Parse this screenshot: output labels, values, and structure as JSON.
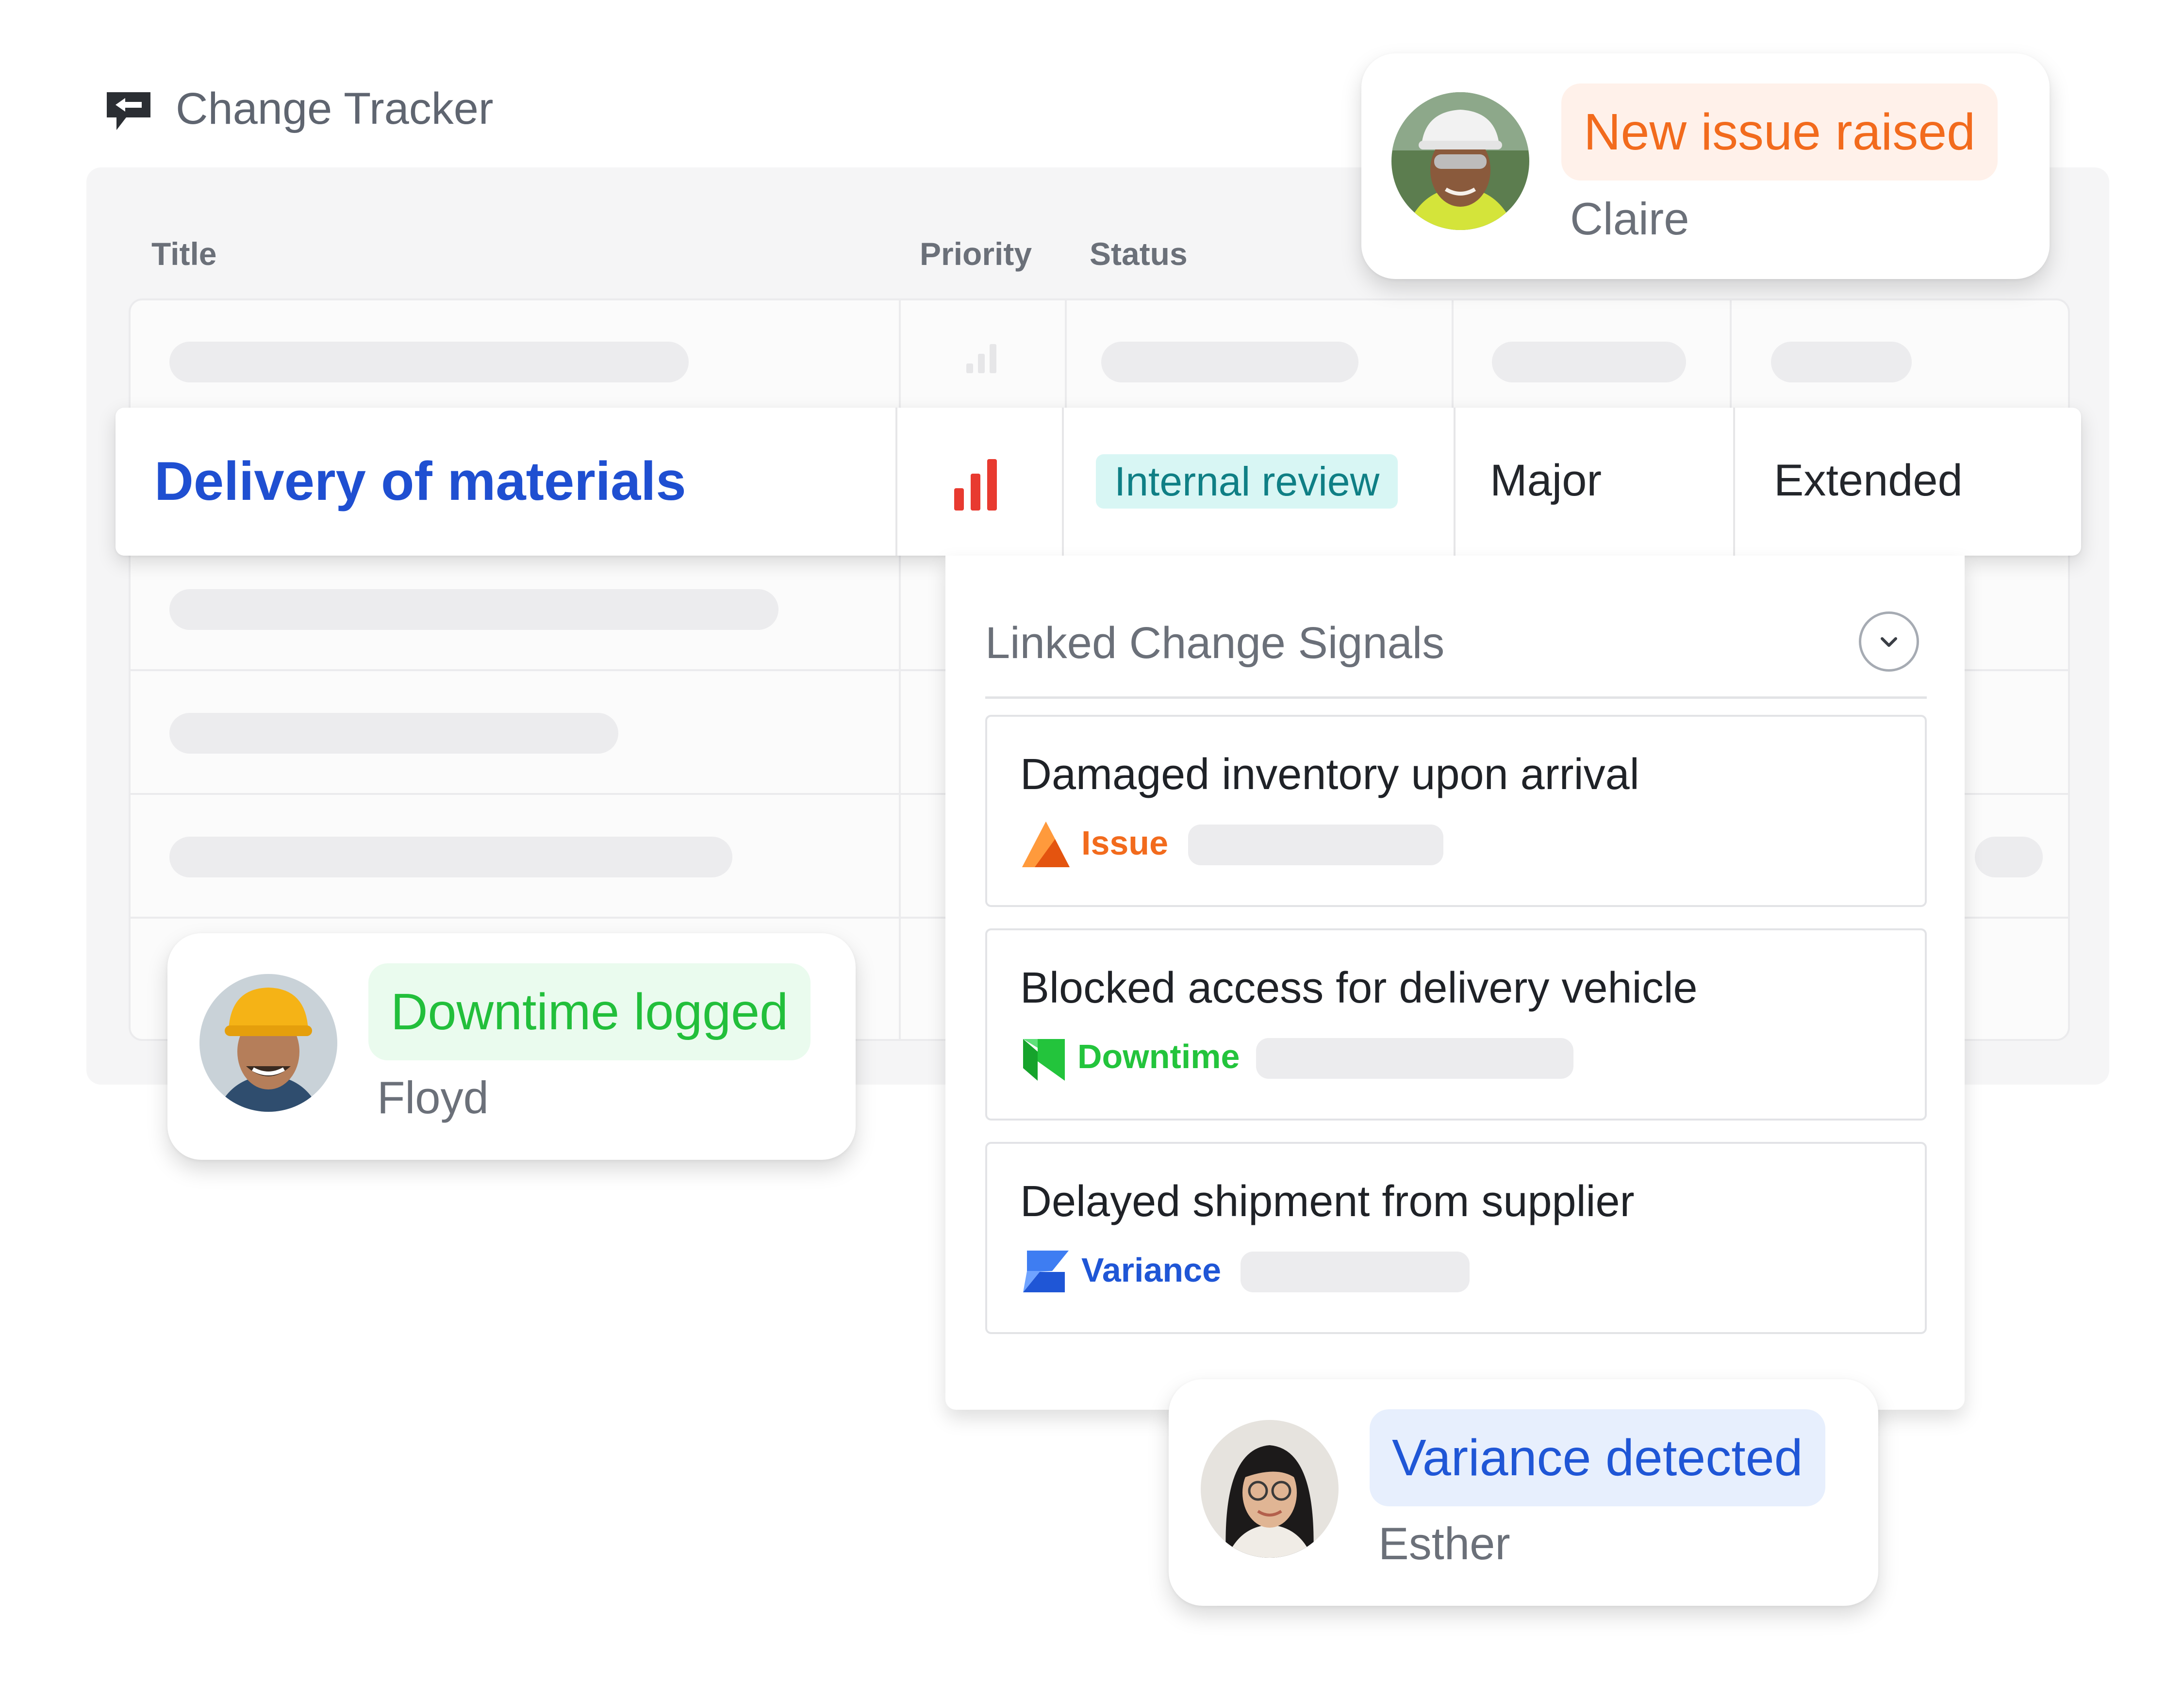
{
  "app": {
    "title": "Change Tracker",
    "logo_icon": "chat-bubble-logo-icon"
  },
  "table": {
    "columns": {
      "title": "Title",
      "priority": "Priority",
      "status": "Status"
    },
    "highlighted_row": {
      "title": "Delivery of materials",
      "priority_icon": "priority-high-bars-icon",
      "status": "Internal review",
      "impact": "Major",
      "schedule": "Extended"
    }
  },
  "signals": {
    "heading": "Linked Change Signals",
    "items": [
      {
        "title": "Damaged inventory upon arrival",
        "type": "Issue",
        "icon": "issue-triangle-icon",
        "color": "#f26b1d"
      },
      {
        "title": "Blocked access for delivery vehicle",
        "type": "Downtime",
        "icon": "downtime-flag-icon",
        "color": "#23c43c"
      },
      {
        "title": "Delayed shipment from supplier",
        "type": "Variance",
        "icon": "variance-z-icon",
        "color": "#1f56d6"
      }
    ]
  },
  "notifications": [
    {
      "message": "New issue raised",
      "person": "Claire",
      "text_color": "#f26b1d",
      "bg_color": "#fff1ea"
    },
    {
      "message": "Downtime logged",
      "person": "Floyd",
      "text_color": "#22bf3b",
      "bg_color": "#eafbee"
    },
    {
      "message": "Variance detected",
      "person": "Esther",
      "text_color": "#1f56d6",
      "bg_color": "#e7effd"
    }
  ]
}
